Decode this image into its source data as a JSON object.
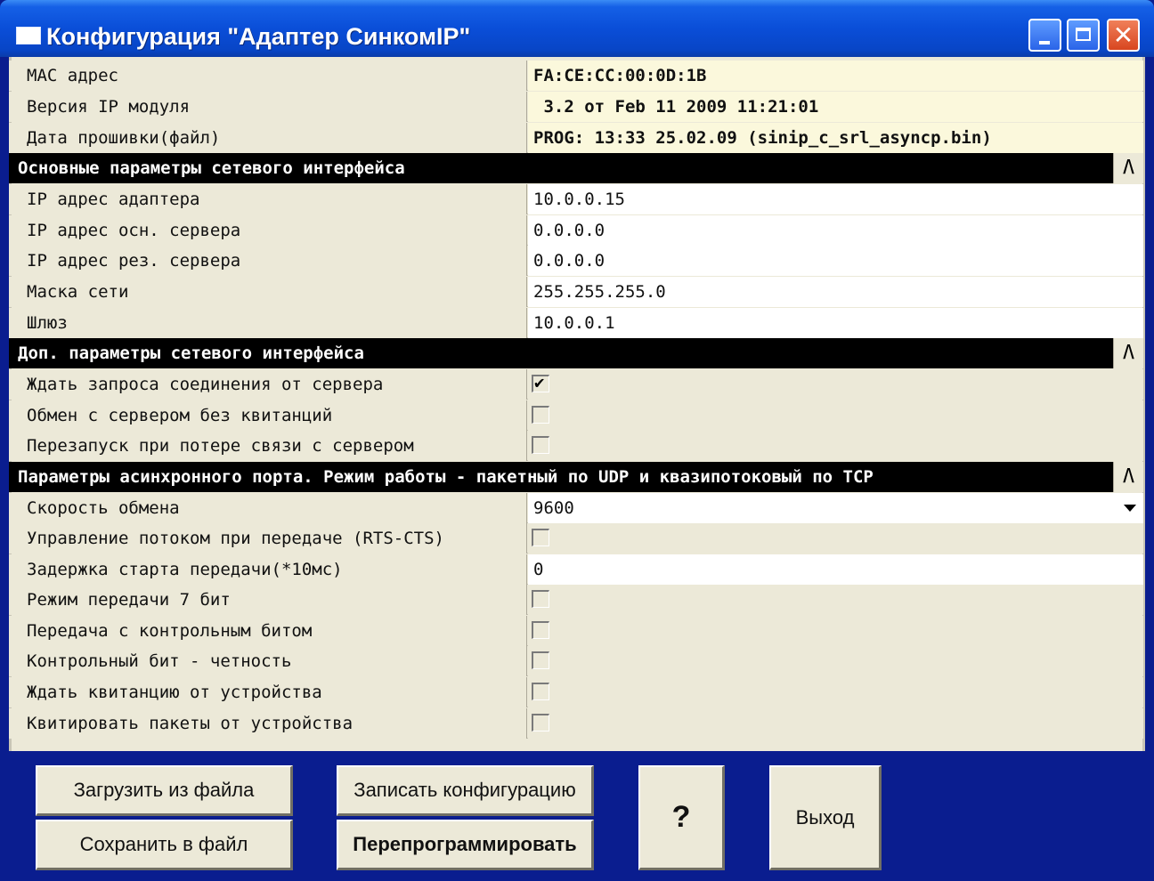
{
  "window": {
    "title": "Конфигурация \"Адаптер СинкомIP\""
  },
  "info": [
    {
      "label": "МАС адрес",
      "value": "FA:CE:CC:00:0D:1B"
    },
    {
      "label": "Версия IP модуля",
      "value": " 3.2 от Feb 11 2009 11:21:01"
    },
    {
      "label": "Дата прошивки(файл)",
      "value": "PROG: 13:33 25.02.09 (sinip_c_srl_asyncp.bin)"
    }
  ],
  "sections": [
    {
      "title": "Основные параметры сетевого интерфейса",
      "collapse": "^",
      "rows": [
        {
          "label": "IP адрес адаптера",
          "value": "10.0.0.15"
        },
        {
          "label": "IP адрес осн. сервера",
          "value": "0.0.0.0"
        },
        {
          "label": "IP адрес рез. сервера",
          "value": "0.0.0.0"
        },
        {
          "label": "Маска сети",
          "value": "255.255.255.0"
        },
        {
          "label": "Шлюз",
          "value": "10.0.0.1"
        }
      ]
    },
    {
      "title": "Доп. параметры сетевого интерфейса",
      "collapse": "^",
      "rows": [
        {
          "label": "Ждать запроса соединения от сервера",
          "checked": true
        },
        {
          "label": "Обмен с сервером без квитанций",
          "checked": false
        },
        {
          "label": "Перезапуск при потере связи с сервером",
          "checked": false
        }
      ]
    },
    {
      "title": "Параметры асинхронного порта. Режим работы - пакетный по UDP и квазипотоковый по TCP",
      "collapse": "^",
      "rows": [
        {
          "label": "Скорость обмена",
          "value": "9600"
        },
        {
          "label": "Управление потоком при передаче (RTS-CTS)",
          "checked": false
        },
        {
          "label": "Задержка старта передачи(*10мс)",
          "value": "0"
        },
        {
          "label": "Режим передачи 7 бит",
          "checked": false
        },
        {
          "label": "Передача с контрольным битом",
          "checked": false
        },
        {
          "label": "Контрольный бит - четность",
          "checked": false
        },
        {
          "label": "Ждать квитанцию от устройства",
          "checked": false
        },
        {
          "label": "Квитировать пакеты от устройства",
          "checked": false
        }
      ]
    }
  ],
  "checkmark": "✔",
  "buttons": {
    "load": "Загрузить из файла",
    "save": "Сохранить в файл",
    "write": "Записать конфигурацию",
    "reprogram": "Перепрограммировать",
    "help": "?",
    "exit": "Выход"
  },
  "colors": {
    "titlebar": "#0a4ed8",
    "panel": "#ece9d8",
    "info_bg": "#fbf8dc",
    "footer": "#0a1d8f"
  }
}
